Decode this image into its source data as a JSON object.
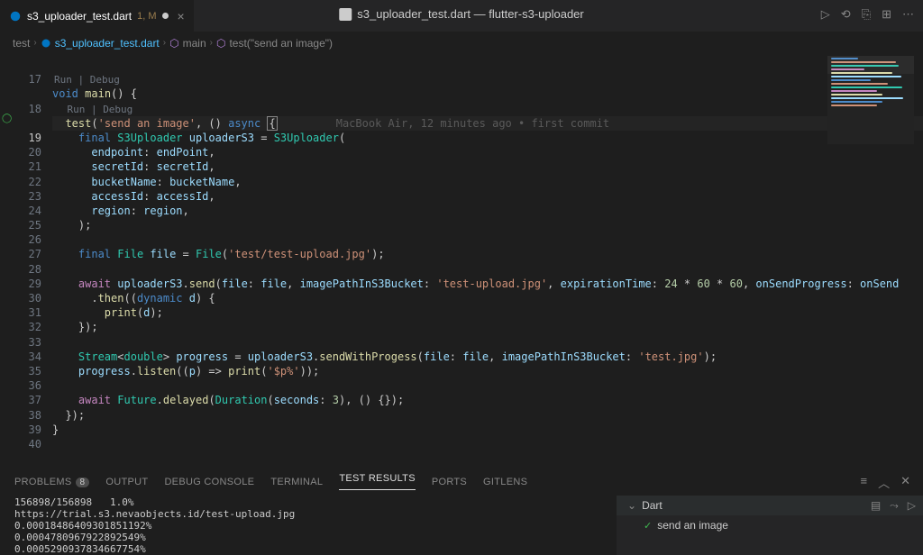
{
  "title": "s3_uploader_test.dart — flutter-s3-uploader",
  "tab": {
    "name": "s3_uploader_test.dart",
    "suffix": "1, M"
  },
  "breadcrumb": {
    "root": "test",
    "file": "s3_uploader_test.dart",
    "fn": "main",
    "test": "test(\"send an image\")"
  },
  "topActions": [
    "▷",
    "⟲",
    "⎘",
    "⊞",
    "⋯"
  ],
  "codelens": {
    "top": "Run | Debug",
    "inner": "Run | Debug"
  },
  "inlineBlame": "MacBook Air, 12 minutes ago • first commit",
  "lines": {
    "first": 17,
    "highlight": 19,
    "last": 40,
    "blueBars": [
      28,
      30
    ]
  },
  "code": {
    "l18": {
      "void": "void",
      "main": "main",
      "rest": "() {"
    },
    "l19": {
      "test": "test",
      "s": "'send an image'",
      "async": "async"
    },
    "l20": {
      "final": "final",
      "type": "S3Uploader",
      "v": "uploaderS3",
      "ctor": "S3Uploader"
    },
    "l21": {
      "k": "endpoint",
      "v": "endPoint"
    },
    "l22": {
      "k": "secretId",
      "v": "secretId"
    },
    "l23": {
      "k": "bucketName",
      "v": "bucketName"
    },
    "l24": {
      "k": "accessId",
      "v": "accessId"
    },
    "l25": {
      "k": "region",
      "v": "region"
    },
    "l26": ");",
    "l28": {
      "final": "final",
      "type": "File",
      "v": "file",
      "ctor": "File",
      "arg": "'test/test-upload.jpg'"
    },
    "l30": {
      "await": "await",
      "obj": "uploaderS3",
      "m": "send",
      "k1": "file",
      "v1": "file",
      "k2": "imagePathInS3Bucket",
      "v2": "'test-upload.jpg'",
      "k3": "expirationTime",
      "expr": "24 * 60 * 60",
      "k4": "onSendProgress",
      "v4": "onSend"
    },
    "l31": {
      "m": "then",
      "dyn": "dynamic",
      "d": "d"
    },
    "l32": {
      "print": "print",
      "arg": "d"
    },
    "l33": "});",
    "l35": {
      "type": "Stream",
      "gen": "double",
      "v": "progress",
      "obj": "uploaderS3",
      "m": "sendWithProgess",
      "k1": "file",
      "v1": "file",
      "k2": "imagePathInS3Bucket",
      "v2": "'test.jpg'"
    },
    "l36": {
      "v": "progress",
      "m": "listen",
      "p": "p",
      "print": "print",
      "arg": "'$p%'"
    },
    "l38": {
      "await": "await",
      "type": "Future",
      "m": "delayed",
      "dur": "Duration",
      "k": "seconds",
      "n": "3"
    },
    "l39": "});",
    "l40": "}"
  },
  "panel": {
    "tabs": {
      "problems": "PROBLEMS",
      "problemsCount": "8",
      "output": "OUTPUT",
      "debug": "DEBUG CONSOLE",
      "terminal": "TERMINAL",
      "test": "TEST RESULTS",
      "ports": "PORTS",
      "gitlens": "GITLENS"
    },
    "terminal": "156898/156898   1.0%\nhttps://trial.s3.nevaobjects.id/test-upload.jpg\n0.00018486409301851192%\n0.0004780967922892549%\n0.0005290937834667754%",
    "tree": {
      "lang": "Dart",
      "item": "send an image"
    }
  },
  "minimapColors": [
    "#4c8bca",
    "#ce9178",
    "#30c9b0",
    "#c586c0",
    "#dcdcaa",
    "#9cdcfe",
    "#4c8bca",
    "#ce9178",
    "#30c9b0",
    "#c586c0",
    "#dcdcaa",
    "#9cdcfe",
    "#4c8bca",
    "#ce9178"
  ]
}
